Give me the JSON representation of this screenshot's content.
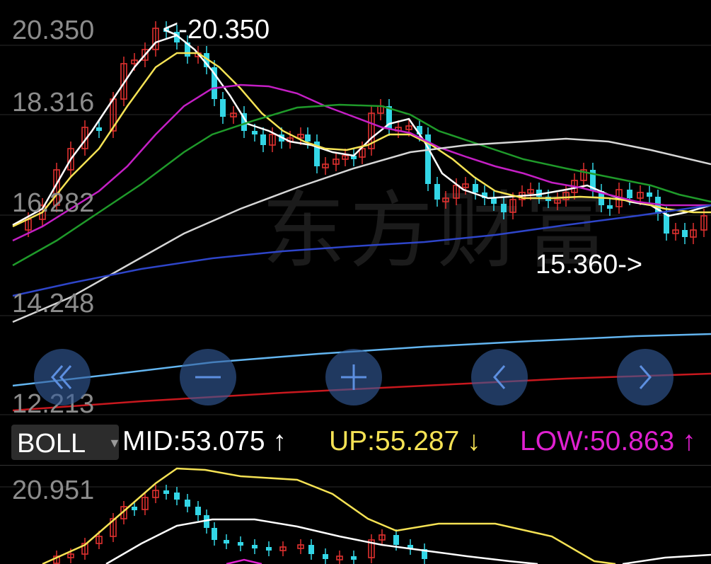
{
  "main_chart": {
    "price_labels": [
      "20.350",
      "18.316",
      "16.282",
      "14.248",
      "12.213"
    ],
    "high_marker": "<-20.350",
    "low_marker": "15.360->",
    "watermark": "东方财富",
    "colors": {
      "up": "#e0312f",
      "down": "#33d6e6",
      "ma5": "#ffffff",
      "ma10": "#f5e254",
      "ma20": "#c41fc4",
      "ma30": "#1f9a2a",
      "ma60": "#d6d6d6",
      "ma120": "#2e45c9",
      "ma250": "#63b5f0",
      "ma_long": "#c8181e"
    }
  },
  "nav_buttons": [
    {
      "name": "rewind",
      "icon": "double-chevron-left-icon"
    },
    {
      "name": "zoom-out",
      "icon": "minus-icon"
    },
    {
      "name": "zoom-in",
      "icon": "plus-icon"
    },
    {
      "name": "prev",
      "icon": "chevron-left-icon"
    },
    {
      "name": "next",
      "icon": "chevron-right-icon"
    }
  ],
  "indicator": {
    "selected": "BOLL",
    "mid": {
      "label": "MID:53.075",
      "arrow": "↑",
      "color": "#ffffff"
    },
    "up": {
      "label": "UP:55.287",
      "arrow": "↓",
      "color": "#f5e254"
    },
    "low": {
      "label": "LOW:50.863",
      "arrow": "↑",
      "color": "#e020d0"
    }
  },
  "sub_chart": {
    "price_label": "20.951",
    "colors": {
      "mid": "#ffffff",
      "upper": "#f5e254",
      "lower": "#e020d0"
    }
  }
}
